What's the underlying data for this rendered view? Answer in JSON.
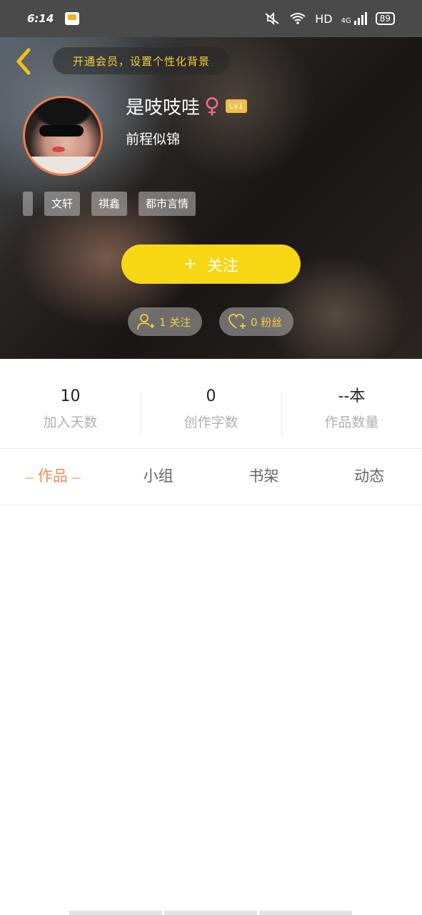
{
  "status_bar": {
    "time": "6:14",
    "network": "HD",
    "cell": "4G",
    "battery": "89"
  },
  "header": {
    "vip_banner": "开通会员，设置个性化背景"
  },
  "profile": {
    "username": "是吱吱哇",
    "gender_symbol": "♀",
    "level": "Lv1",
    "signature": "前程似锦",
    "tags": [
      "",
      "文轩",
      "祺鑫",
      "都市言情"
    ],
    "follow_button": "关注",
    "follow_plus": "+",
    "following_count": "1 关注",
    "fans_count": "0 粉丝"
  },
  "stats": [
    {
      "value": "10",
      "label": "加入天数"
    },
    {
      "value": "0",
      "label": "创作字数"
    },
    {
      "value": "--本",
      "label": "作品数量"
    }
  ],
  "tabs": [
    {
      "label": "作品",
      "active": true
    },
    {
      "label": "小组",
      "active": false
    },
    {
      "label": "书架",
      "active": false
    },
    {
      "label": "动态",
      "active": false
    }
  ],
  "colors": {
    "accent_yellow": "#f7d613",
    "accent_orange": "#f08a55",
    "vip_text": "#f6cf3b"
  }
}
